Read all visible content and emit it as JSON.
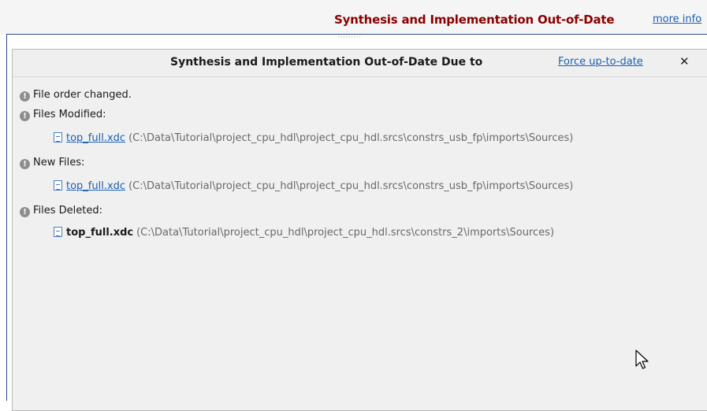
{
  "banner": {
    "title": "Synthesis and Implementation Out-of-Date",
    "more_info": "more info",
    "grip": "·········"
  },
  "panel": {
    "title": "Synthesis and Implementation Out-of-Date Due to",
    "force_link": "Force up-to-date",
    "close": "✕"
  },
  "messages": [
    {
      "label": "File order changed."
    },
    {
      "label": "Files Modified:",
      "file": "top_full.xdc",
      "path": "(C:\\Data\\Tutorial\\project_cpu_hdl\\project_cpu_hdl.srcs\\constrs_usb_fp\\imports\\Sources)"
    },
    {
      "label": "New Files:",
      "file": "top_full.xdc",
      "path": "(C:\\Data\\Tutorial\\project_cpu_hdl\\project_cpu_hdl.srcs\\constrs_usb_fp\\imports\\Sources)"
    },
    {
      "label": "Files Deleted:",
      "file": "top_full.xdc",
      "path": "(C:\\Data\\Tutorial\\project_cpu_hdl\\project_cpu_hdl.srcs\\constrs_2\\imports\\Sources)"
    }
  ],
  "icons": {
    "info": "info-icon",
    "file": "file-icon",
    "cursor": "mouse-pointer-icon"
  }
}
